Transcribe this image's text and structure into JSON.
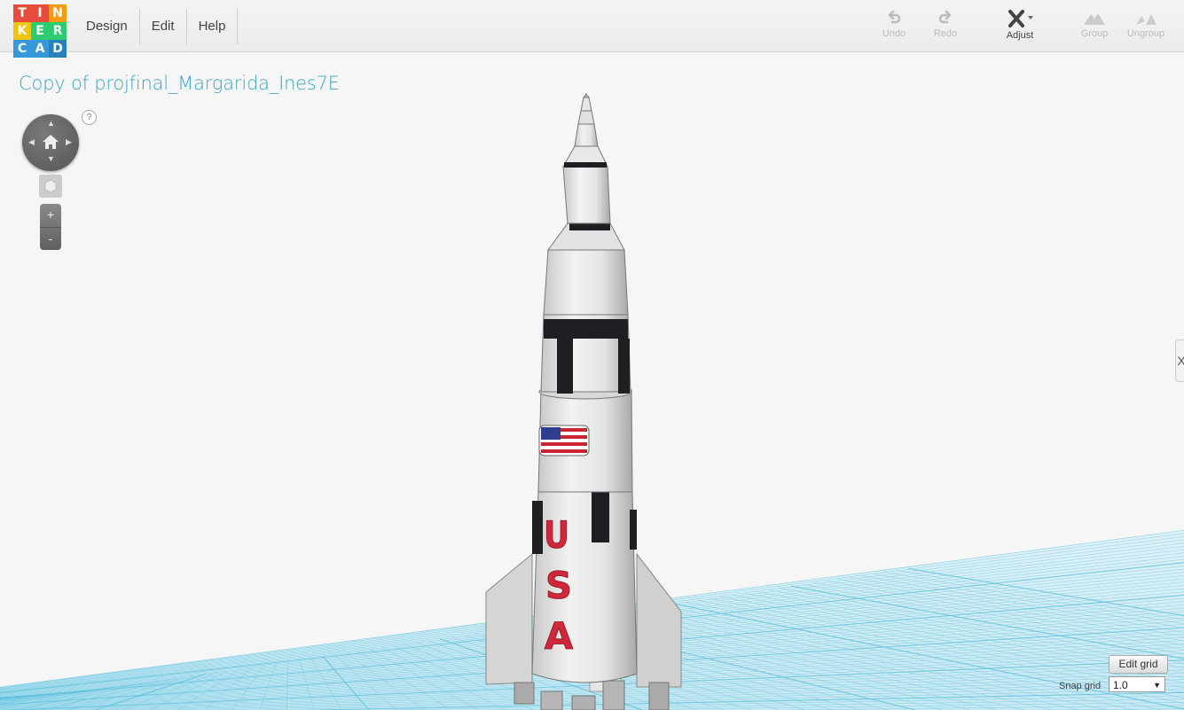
{
  "app": {
    "logo_letters": [
      "T",
      "I",
      "N",
      "K",
      "E",
      "R",
      "C",
      "A",
      "D"
    ],
    "logo_colors": [
      "#e84c3d",
      "#e84c3d",
      "#f39c12",
      "#f1c40f",
      "#2ecc71",
      "#2ecc71",
      "#3498db",
      "#3498db",
      "#2980b9"
    ]
  },
  "menu": {
    "design": "Design",
    "edit": "Edit",
    "help": "Help"
  },
  "toolbar": {
    "undo": "Undo",
    "redo": "Redo",
    "adjust": "Adjust",
    "group": "Group",
    "ungroup": "Ungroup"
  },
  "design": {
    "title": "Copy of projfinal_Margarida_Ines7E"
  },
  "view": {
    "help": "?",
    "zoom_in": "+",
    "zoom_out": "-"
  },
  "grid": {
    "edit_label": "Edit grid",
    "snap_label": "Snap grid",
    "snap_value": "1.0",
    "color": "#5bc0de"
  },
  "rocket": {
    "text": [
      "U",
      "S",
      "A"
    ],
    "text_color": "#d0283a"
  },
  "side_tab": "X"
}
